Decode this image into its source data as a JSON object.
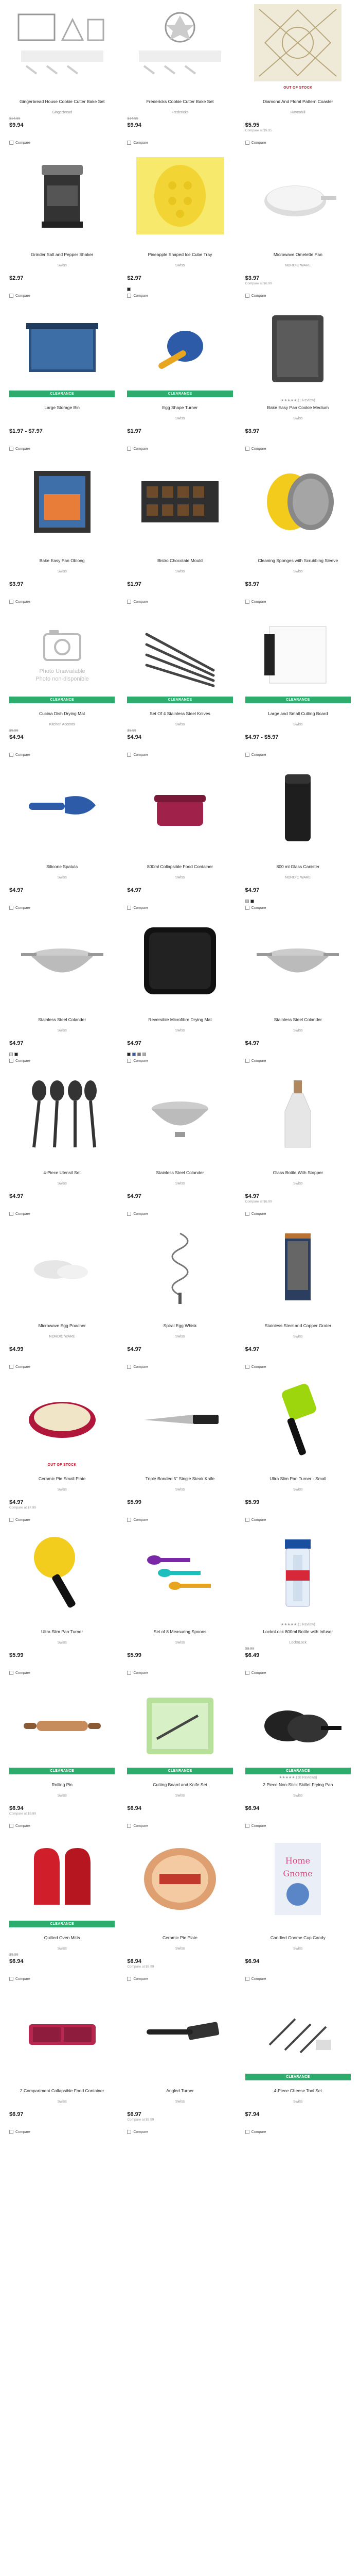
{
  "compare_label": "Compare",
  "products": [
    {
      "name": "Gingerbread House Cookie Cutter Bake Set",
      "brand": "Gingerbread",
      "was": "$14.95",
      "price": "$9.94",
      "note": "",
      "tag": "",
      "rating": ""
    },
    {
      "name": "Fredericks Cookie Cutter Bake Set",
      "brand": "Fredericks",
      "was": "$14.95",
      "price": "$9.94",
      "note": "",
      "tag": "",
      "rating": ""
    },
    {
      "name": "Diamond And Floral Pattern Coaster",
      "brand": "Ravenhill",
      "was": "",
      "price": "$5.95",
      "note": "Compare at $9.95",
      "tag": "OUT OF STOCK",
      "rating": ""
    },
    {
      "name": "Grinder Salt and Pepper Shaker",
      "brand": "Swiss",
      "was": "",
      "price": "$2.97",
      "note": "",
      "tag": "",
      "rating": ""
    },
    {
      "name": "Pineapple Shaped Ice Cube Tray",
      "brand": "Swiss",
      "was": "",
      "price": "$2.97",
      "note": "",
      "tag": "",
      "rating": ""
    },
    {
      "name": "Microwave Omelette Pan",
      "brand": "NORDIC WARE",
      "was": "",
      "price": "$3.97",
      "note": "Compare at $6.99",
      "tag": "",
      "rating": ""
    },
    {
      "name": "Large Storage Bin",
      "brand": "",
      "was": "",
      "price": "$1.97 - $7.97",
      "note": "",
      "tag": "CLEARANCE",
      "rating": ""
    },
    {
      "name": "Egg Shape Turner",
      "brand": "Swiss",
      "was": "",
      "price": "$1.97",
      "note": "",
      "tag": "CLEARANCE",
      "rating": ""
    },
    {
      "name": "Bake Easy Pan Cookie Medium",
      "brand": "Swiss",
      "was": "",
      "price": "$3.97",
      "note": "",
      "tag": "",
      "rating": "★★★★★ (1 Review)"
    },
    {
      "name": "Bake Easy Pan Oblong",
      "brand": "Swiss",
      "was": "",
      "price": "$3.97",
      "note": "",
      "tag": "",
      "rating": ""
    },
    {
      "name": "Bistro Chocolate Mould",
      "brand": "Swiss",
      "was": "",
      "price": "$1.97",
      "note": "",
      "tag": "",
      "rating": ""
    },
    {
      "name": "Cleaning Sponges with Scrubbing Sleeve",
      "brand": "Swiss",
      "was": "",
      "price": "$3.97",
      "note": "",
      "tag": "",
      "rating": ""
    },
    {
      "name": "Cucina Dish Drying Mat",
      "brand": "Kitchen Accents",
      "was": "$9.99",
      "price": "$4.94",
      "note": "",
      "tag": "CLEARANCE",
      "rating": ""
    },
    {
      "name": "Set Of 4 Stainless Steel Knives",
      "brand": "Swiss",
      "was": "$9.99",
      "price": "$4.94",
      "note": "",
      "tag": "CLEARANCE",
      "rating": ""
    },
    {
      "name": "Large and Small Cutting Board",
      "brand": "Swiss",
      "was": "",
      "price": "$4.97 - $5.97",
      "note": "",
      "tag": "CLEARANCE",
      "rating": ""
    },
    {
      "name": "Silicone Spatula",
      "brand": "Swiss",
      "was": "",
      "price": "$4.97",
      "note": "",
      "tag": "",
      "rating": ""
    },
    {
      "name": "800ml Collapsible Food Container",
      "brand": "Swiss",
      "was": "",
      "price": "$4.97",
      "note": "",
      "tag": "",
      "rating": ""
    },
    {
      "name": "800 ml Glass Canister",
      "brand": "NORDIC WARE",
      "was": "",
      "price": "$4.97",
      "note": "",
      "tag": "",
      "rating": ""
    },
    {
      "name": "Stainless Steel Colander",
      "brand": "Swiss",
      "was": "",
      "price": "$4.97",
      "note": "",
      "tag": "",
      "rating": ""
    },
    {
      "name": "Reversible Microfibre Drying Mat",
      "brand": "Swiss",
      "was": "",
      "price": "$4.97",
      "note": "",
      "tag": "",
      "rating": ""
    },
    {
      "name": "Stainless Steel Colander",
      "brand": "Swiss",
      "was": "",
      "price": "$4.97",
      "note": "",
      "tag": "",
      "rating": ""
    },
    {
      "name": "4-Piece Utensil Set",
      "brand": "Swiss",
      "was": "",
      "price": "$4.97",
      "note": "",
      "tag": "",
      "rating": ""
    },
    {
      "name": "Stainless Steel Colander",
      "brand": "Swiss",
      "was": "",
      "price": "$4.97",
      "note": "",
      "tag": "",
      "rating": ""
    },
    {
      "name": "Glass Bottle With Stopper",
      "brand": "Swiss",
      "was": "",
      "price": "$4.97",
      "note": "Compare at $6.99",
      "tag": "",
      "rating": ""
    },
    {
      "name": "Microwave Egg Poacher",
      "brand": "NORDIC WARE",
      "was": "",
      "price": "$4.99",
      "note": "",
      "tag": "",
      "rating": ""
    },
    {
      "name": "Spiral Egg Whisk",
      "brand": "Swiss",
      "was": "",
      "price": "$4.97",
      "note": "",
      "tag": "",
      "rating": ""
    },
    {
      "name": "Stainless Steel and Copper Grater",
      "brand": "Swiss",
      "was": "",
      "price": "$4.97",
      "note": "",
      "tag": "",
      "rating": ""
    },
    {
      "name": "Ceramic Pie Small Plate",
      "brand": "Swiss",
      "was": "",
      "price": "$4.97",
      "note": "Compare at $7.99",
      "tag": "OUT OF STOCK",
      "rating": ""
    },
    {
      "name": "Triple Bonded 5\" Single Steak Knife",
      "brand": "Swiss",
      "was": "",
      "price": "$5.99",
      "note": "",
      "tag": "",
      "rating": ""
    },
    {
      "name": "Ultra Slim Pan Turner - Small",
      "brand": "Swiss",
      "was": "",
      "price": "$5.99",
      "note": "",
      "tag": "",
      "rating": ""
    },
    {
      "name": "Ultra Slim Pan Turner",
      "brand": "Swiss",
      "was": "",
      "price": "$5.99",
      "note": "",
      "tag": "",
      "rating": ""
    },
    {
      "name": "Set of 8 Measuring Spoons",
      "brand": "Swiss",
      "was": "",
      "price": "$5.99",
      "note": "",
      "tag": "",
      "rating": ""
    },
    {
      "name": "LocknLock 800ml Bottle with Infuser",
      "brand": "LocknLock",
      "was": "$9.99",
      "price": "$6.49",
      "note": "",
      "tag": "",
      "rating": "★★★★★ (1 Review)"
    },
    {
      "name": "Rolling Pin",
      "brand": "Swiss",
      "was": "",
      "price": "$6.94",
      "note": "Compare at $9.99",
      "tag": "CLEARANCE",
      "rating": ""
    },
    {
      "name": "Cutting Board and Knife Set",
      "brand": "Swiss",
      "was": "",
      "price": "$6.94",
      "note": "",
      "tag": "CLEARANCE",
      "rating": ""
    },
    {
      "name": "2 Piece Non-Stick Skillet Frying Pan",
      "brand": "Swiss",
      "was": "",
      "price": "$6.94",
      "note": "",
      "tag": "CLEARANCE",
      "rating": "★★★★★ (10 Reviews)"
    },
    {
      "name": "Quilted Oven Mitts",
      "brand": "Swiss",
      "was": "$9.99",
      "price": "$6.94",
      "note": "",
      "tag": "CLEARANCE",
      "rating": ""
    },
    {
      "name": "Ceramic Pie Plate",
      "brand": "Swiss",
      "was": "",
      "price": "$6.94",
      "note": "Compare at $9.99",
      "tag": "",
      "rating": ""
    },
    {
      "name": "Candied Gnome Cup Candy",
      "brand": "Swiss",
      "was": "",
      "price": "$6.94",
      "note": "",
      "tag": "",
      "rating": ""
    },
    {
      "name": "2 Compartment Collapsible Food Container",
      "brand": "Swiss",
      "was": "",
      "price": "$6.97",
      "note": "",
      "tag": "",
      "rating": ""
    },
    {
      "name": "Angled Turner",
      "brand": "Swiss",
      "was": "",
      "price": "$6.97",
      "note": "Compare at $9.99",
      "tag": "",
      "rating": ""
    },
    {
      "name": "4-Piece Cheese Tool Set",
      "brand": "Swiss",
      "was": "",
      "price": "$7.94",
      "note": "",
      "tag": "CLEARANCE",
      "rating": ""
    }
  ]
}
